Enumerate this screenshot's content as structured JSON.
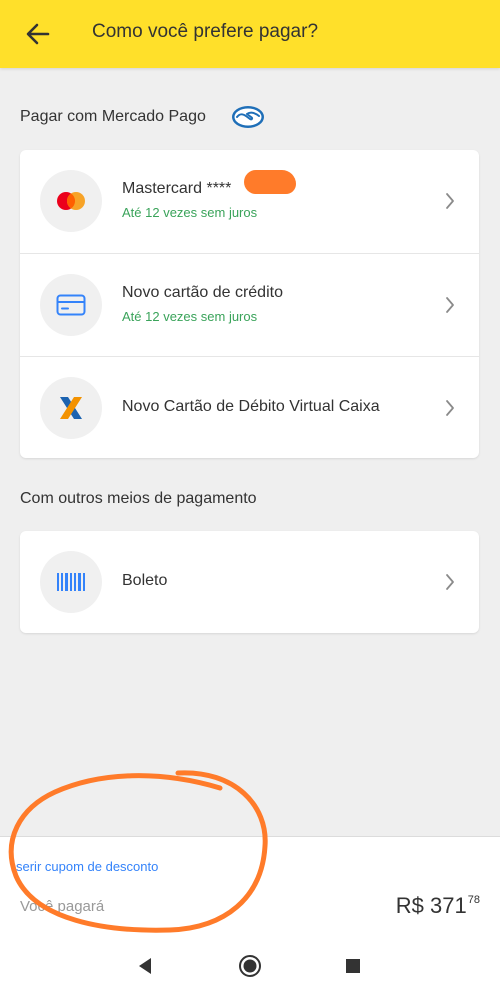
{
  "header": {
    "title": "Como você prefere pagar?"
  },
  "section_mp": {
    "title": "Pagar com Mercado Pago"
  },
  "mp_methods": [
    {
      "title": "Mastercard ****",
      "subtitle": "Até 12 vezes sem juros"
    },
    {
      "title": "Novo cartão de crédito",
      "subtitle": "Até 12 vezes sem juros"
    },
    {
      "title": "Novo Cartão de Débito Virtual Caixa"
    }
  ],
  "section_other": {
    "title": "Com outros meios de pagamento"
  },
  "other_methods": [
    {
      "title": "Boleto"
    }
  ],
  "footer": {
    "coupon_link": "serir cupom de desconto",
    "pay_label": "Você pagará",
    "amount_main": "R$ 371",
    "amount_cents": "78"
  },
  "colors": {
    "header_bg": "#ffe02a",
    "installments_green": "#3aa35a",
    "link_blue": "#3483fa",
    "annotation_orange": "#ff7b2a"
  }
}
